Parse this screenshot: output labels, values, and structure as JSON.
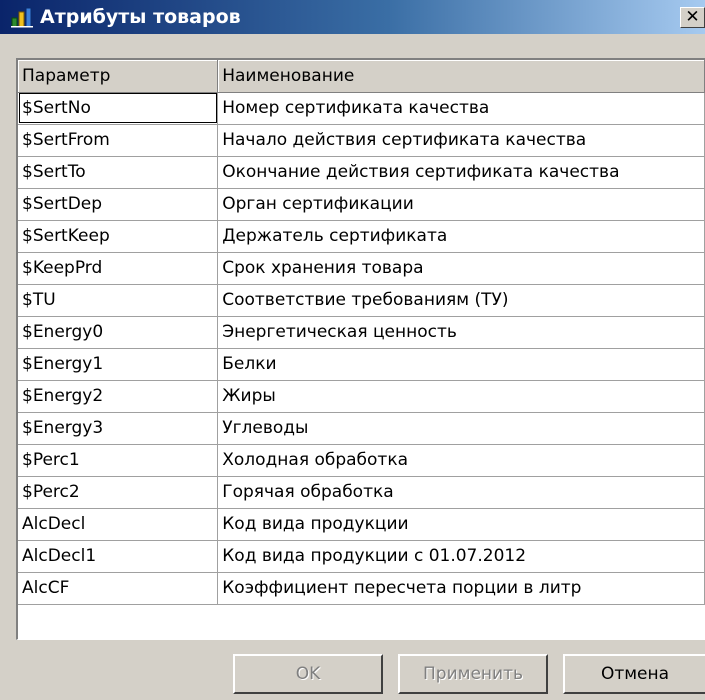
{
  "window": {
    "title": "Атрибуты товаров",
    "icon": "app-chart-icon",
    "close_label": "✕"
  },
  "grid": {
    "columns": [
      "Параметр",
      "Наименование"
    ],
    "rows": [
      {
        "param": "$SertNo",
        "name": "Номер сертификата качества"
      },
      {
        "param": "$SertFrom",
        "name": "Начало действия сертификата качества"
      },
      {
        "param": "$SertTo",
        "name": "Окончание действия сертификата качества"
      },
      {
        "param": "$SertDep",
        "name": "Орган сертификации"
      },
      {
        "param": "$SertKeep",
        "name": "Держатель сертификата"
      },
      {
        "param": "$KeepPrd",
        "name": "Срок хранения товара"
      },
      {
        "param": "$TU",
        "name": "Соответствие требованиям (ТУ)"
      },
      {
        "param": "$Energy0",
        "name": "Энергетическая ценность"
      },
      {
        "param": "$Energy1",
        "name": "Белки"
      },
      {
        "param": "$Energy2",
        "name": "Жиры"
      },
      {
        "param": "$Energy3",
        "name": "Углеводы"
      },
      {
        "param": "$Perc1",
        "name": "Холодная обработка"
      },
      {
        "param": "$Perc2",
        "name": "Горячая обработка"
      },
      {
        "param": "AlcDecl",
        "name": "Код вида продукции"
      },
      {
        "param": "AlcDecl1",
        "name": "Код вида продукции с 01.07.2012"
      },
      {
        "param": "AlcCF",
        "name": "Коэффициент пересчета порции в литр"
      }
    ]
  },
  "buttons": {
    "ok": "OK",
    "apply": "Применить",
    "cancel": "Отмена"
  }
}
